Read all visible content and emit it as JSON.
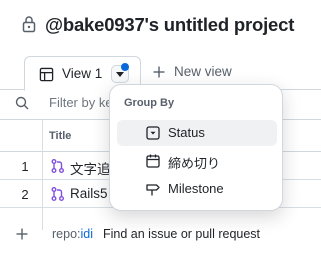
{
  "header": {
    "lock_icon": "lock-icon",
    "title": "@bake0937's untitled project"
  },
  "tabs": {
    "view_tab": {
      "icon": "table-icon",
      "label": "View 1"
    },
    "new_view": {
      "icon": "plus-icon",
      "label": "New view"
    }
  },
  "filter": {
    "icon": "filter-icon",
    "placeholder": "Filter by keyword or by field"
  },
  "table": {
    "columns": [
      "Title"
    ],
    "rows": [
      {
        "number": "1",
        "icon": "git-pull-request-icon",
        "title": "文字追"
      },
      {
        "number": "2",
        "icon": "git-pull-request-icon",
        "title": "Rails5"
      }
    ],
    "add_row": {
      "icon": "plus-icon",
      "repo_prefix": "repo:",
      "repo_name": "idi",
      "placeholder": "Find an issue or pull request"
    }
  },
  "group_by_menu": {
    "heading": "Group By",
    "items": [
      {
        "label": "Status",
        "icon": "single-select-icon",
        "active": true
      },
      {
        "label": "締め切り",
        "icon": "calendar-icon",
        "active": false
      },
      {
        "label": "Milestone",
        "icon": "milestone-icon",
        "active": false
      }
    ]
  },
  "colors": {
    "accent": "#0969da",
    "pr_open": "#8250df",
    "text": "#1f2328",
    "muted": "#57606a",
    "border": "#d0d7de"
  }
}
